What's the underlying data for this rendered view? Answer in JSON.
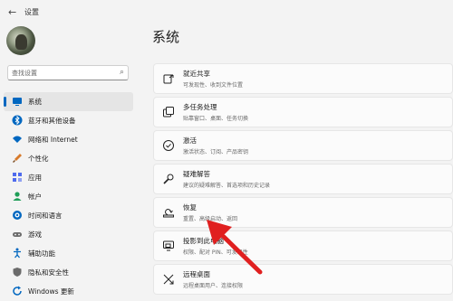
{
  "window": {
    "title": "设置",
    "back_icon": "back-arrow-icon"
  },
  "sidebar": {
    "search_placeholder": "查找设置",
    "items": [
      {
        "label": "系统",
        "icon": "system-icon",
        "color": "#0067c0",
        "active": true
      },
      {
        "label": "蓝牙和其他设备",
        "icon": "bluetooth-icon",
        "color": "#0067c0"
      },
      {
        "label": "网络和 Internet",
        "icon": "wifi-icon",
        "color": "#0067c0"
      },
      {
        "label": "个性化",
        "icon": "brush-icon",
        "color": "#d77a2b"
      },
      {
        "label": "应用",
        "icon": "apps-icon",
        "color": "#4f6bed"
      },
      {
        "label": "帐户",
        "icon": "account-icon",
        "color": "#1f9e58"
      },
      {
        "label": "时间和语言",
        "icon": "globe-icon",
        "color": "#0067c0"
      },
      {
        "label": "游戏",
        "icon": "game-icon",
        "color": "#6b6b6b"
      },
      {
        "label": "辅助功能",
        "icon": "accessibility-icon",
        "color": "#0067c0"
      },
      {
        "label": "隐私和安全性",
        "icon": "shield-icon",
        "color": "#6b6b6b"
      },
      {
        "label": "Windows 更新",
        "icon": "update-icon",
        "color": "#0067c0"
      }
    ]
  },
  "main": {
    "title": "系统",
    "cards": [
      {
        "title": "就近共享",
        "subtitle": "可发现性、收到文件位置",
        "icon": "nearby-share-icon"
      },
      {
        "title": "多任务处理",
        "subtitle": "贴靠窗口、桌面、任务切换",
        "icon": "multitask-icon"
      },
      {
        "title": "激活",
        "subtitle": "激活状态、订阅、产品密钥",
        "icon": "activation-icon"
      },
      {
        "title": "疑难解答",
        "subtitle": "建议的疑难解答、首选项和历史记录",
        "icon": "troubleshoot-icon"
      },
      {
        "title": "恢复",
        "subtitle": "重置、高级启动、返回",
        "icon": "recovery-icon"
      },
      {
        "title": "投影到此电脑",
        "subtitle": "权限、配对 PIN、可发现性",
        "icon": "project-icon"
      },
      {
        "title": "远程桌面",
        "subtitle": "远程桌面用户、连接权限",
        "icon": "remote-desktop-icon"
      }
    ]
  },
  "annotation": {
    "arrow_color": "#e02020",
    "points_to": "恢复"
  }
}
